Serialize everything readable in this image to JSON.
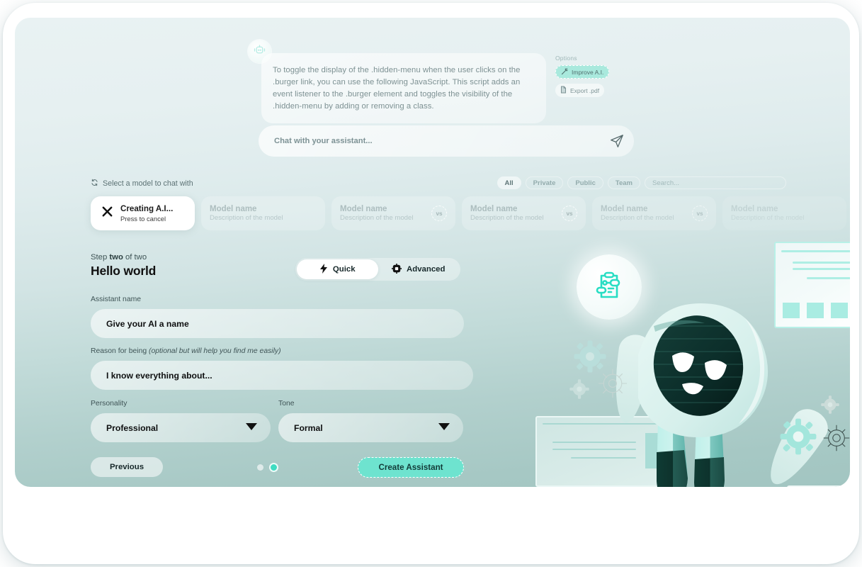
{
  "chat": {
    "bot_avatar_icon": "robot-icon",
    "message": "To toggle the display of the .hidden-menu when the user clicks on the .burger link, you can use the following JavaScript. This script adds an event listener to the .burger element and toggles the visibility of the .hidden-menu by adding or removing a class.",
    "input_placeholder": "Chat with your assistant...",
    "send_icon": "send-icon"
  },
  "options": {
    "title": "Options",
    "improve_label": "Improve A.I.",
    "improve_icon": "magic-wand-icon",
    "export_label": "Export .pdf",
    "export_icon": "file-icon"
  },
  "model_selector": {
    "label": "Select a model to chat with",
    "label_icon": "refresh-icon",
    "filters": [
      "All",
      "Private",
      "Public",
      "Team"
    ],
    "active_filter": "All",
    "search_placeholder": "Search...",
    "selected_card": {
      "title": "Creating A.I...",
      "subtitle": "Press to cancel",
      "icon": "close-icon"
    },
    "cards": [
      {
        "name": "Model name",
        "desc": "Description of the model",
        "badge": ""
      },
      {
        "name": "Model name",
        "desc": "Description of the model",
        "badge": "vs"
      },
      {
        "name": "Model name",
        "desc": "Description of the model",
        "badge": "vs"
      },
      {
        "name": "Model name",
        "desc": "Description of the model",
        "badge": "vs"
      },
      {
        "name": "Model name",
        "desc": "Description of the model",
        "badge": ""
      }
    ]
  },
  "wizard": {
    "step_prefix": "Step ",
    "step_current": "two",
    "step_suffix": " of two",
    "heading": "Hello world",
    "modes": [
      {
        "label": "Quick",
        "icon": "bolt-icon",
        "active": true
      },
      {
        "label": "Advanced",
        "icon": "chip-icon",
        "active": false
      }
    ],
    "fields": {
      "name_label": "Assistant name",
      "name_value": "Give your AI a name",
      "reason_label": "Reason for being ",
      "reason_label_hint": "(optional but will help you find me easily)",
      "reason_value": "I know everything about...",
      "personality_label": "Personality",
      "personality_value": "Professional",
      "tone_label": "Tone",
      "tone_value": "Formal",
      "caret_icon": "chevron-down-icon"
    },
    "previous_label": "Previous",
    "create_label": "Create Assistant",
    "pagination": {
      "total": 2,
      "active_index": 1
    }
  },
  "illustration": {
    "badge_icon": "clipboard-settings-icon",
    "robot_icon": "robot-mascot"
  },
  "colors": {
    "accent": "#3fdcc2",
    "accent_soft": "#6ee3cf",
    "bg_top": "#e9f2f3",
    "bg_bottom": "#a2c5c1",
    "robot_dark": "#0d2c29"
  }
}
